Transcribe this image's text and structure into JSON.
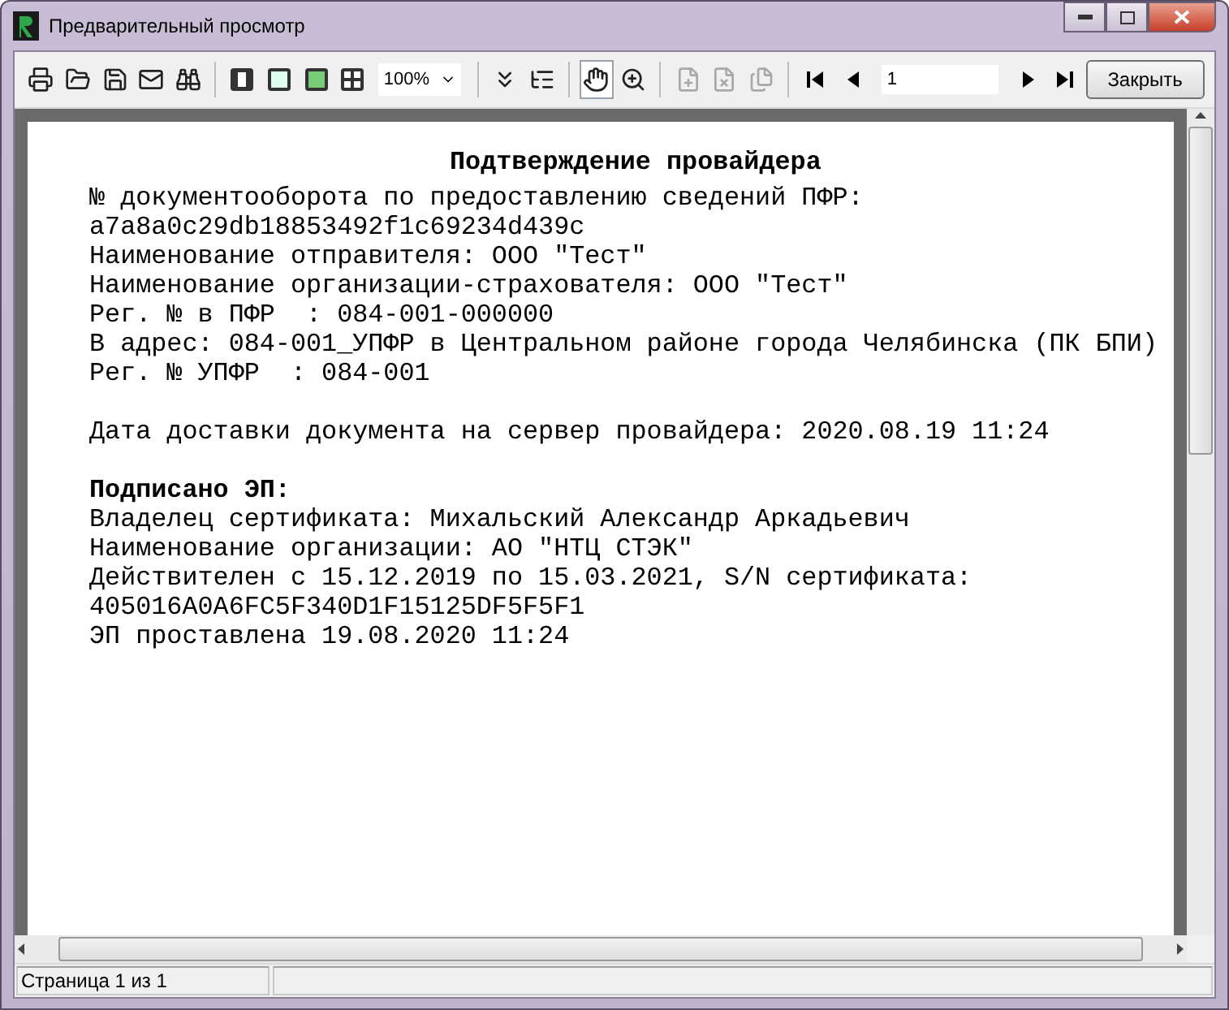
{
  "window": {
    "title": "Предварительный просмотр"
  },
  "toolbar": {
    "tools": [
      {
        "disabled": false,
        "selected": false
      },
      {
        "disabled": false,
        "selected": false
      },
      {
        "disabled": false,
        "selected": false
      },
      {
        "disabled": false,
        "selected": false
      },
      {
        "disabled": false,
        "selected": false
      },
      {
        "disabled": false,
        "selected": false
      },
      {
        "disabled": false,
        "selected": false
      },
      {
        "disabled": false,
        "selected": false
      },
      {
        "disabled": false,
        "selected": false
      }
    ],
    "zoom": "100%",
    "tools2": [
      {
        "disabled": false,
        "selected": false
      },
      {
        "disabled": false,
        "selected": false
      },
      {
        "disabled": false,
        "selected": true
      },
      {
        "disabled": false,
        "selected": false
      },
      {
        "disabled": true,
        "selected": false
      },
      {
        "disabled": true,
        "selected": false
      },
      {
        "disabled": true,
        "selected": false
      }
    ],
    "page": "1",
    "close_button": "Закрыть"
  },
  "document": {
    "lines": [
      {
        "kind": "heading",
        "text": "Подтверждение провайдера"
      },
      {
        "kind": "line",
        "text": "№ документооборота по предоставлению сведений ПФР:"
      },
      {
        "kind": "line",
        "text": "a7a8a0c29db18853492f1c69234d439c"
      },
      {
        "kind": "line",
        "text": "Наименование отправителя: ООО \"Тест\""
      },
      {
        "kind": "line",
        "text": "Наименование организации-страхователя: ООО \"Тест\""
      },
      {
        "kind": "line",
        "text": "Рег. № в ПФР  : 084-001-000000"
      },
      {
        "kind": "line",
        "text": "В адрес: 084-001_УПФР в Центральном районе города Челябинска (ПК БПИ)"
      },
      {
        "kind": "line",
        "text": "Рег. № УПФР  : 084-001"
      },
      {
        "kind": "spaced",
        "text": "Дата доставки документа на сервер провайдера: 2020.08.19 11:24"
      },
      {
        "kind": "spaced_bold",
        "text": "Подписано ЭП:"
      },
      {
        "kind": "line",
        "text": "Владелец сертификата: Михальский Александр Аркадьевич"
      },
      {
        "kind": "line",
        "text": "Наименование организации: АО \"НТЦ СТЭК\""
      },
      {
        "kind": "line",
        "text": "Действителен с 15.12.2019 по 15.03.2021, S/N сертификата:"
      },
      {
        "kind": "line",
        "text": "405016A0A6FC5F340D1F15125DF5F5F1"
      },
      {
        "kind": "line",
        "text": "ЭП проставлена 19.08.2020 11:24"
      }
    ]
  },
  "status_bar": {
    "page": "Страница 1 из 1"
  }
}
